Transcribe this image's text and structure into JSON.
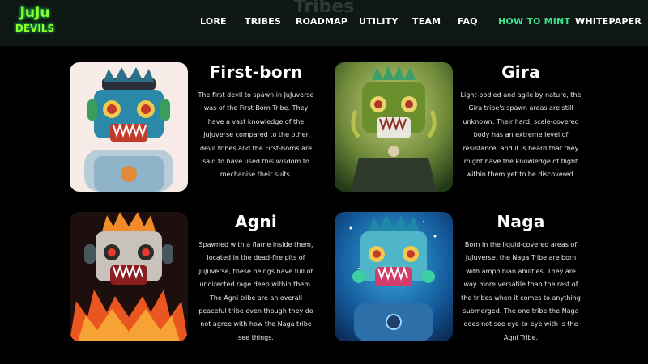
{
  "header": {
    "logo_line1": "JuJu",
    "logo_line2": "DEVILS",
    "ghost_heading": "Tribes",
    "nav": [
      {
        "label": "LORE",
        "active": false
      },
      {
        "label": "TRIBES",
        "active": false
      },
      {
        "label": "ROADMAP",
        "active": false
      },
      {
        "label": "UTILITY",
        "active": false
      },
      {
        "label": "TEAM",
        "active": false
      },
      {
        "label": "FAQ",
        "active": false
      },
      {
        "label": "HOW TO MINT",
        "active": true
      },
      {
        "label": "WHITEPAPER",
        "active": false
      }
    ]
  },
  "colors": {
    "accent": "#3fe08c",
    "logo_green": "#8dff2c",
    "nav_bg": "#0e1714",
    "page_bg": "#000000"
  },
  "tribes": [
    {
      "name": "First-born",
      "image_icon": "first-born-devil-portrait",
      "description": "The first devil to spawn in JuJuverse was of the First-Born Tribe. They have a vast knowledge of the JuJuverse compared to the other devil tribes and the First-Borns are said to have used this wisdom to mechanise their suits."
    },
    {
      "name": "Gira",
      "image_icon": "gira-devil-portrait",
      "description": "Light-bodied and agile by nature, the Gira tribe's spawn areas are still unknown. Their hard, scale-covered body has an extreme level of resistance, and it is heard that they might have the knowledge of flight within them yet to be discovered."
    },
    {
      "name": "Agni",
      "image_icon": "agni-devil-portrait",
      "description": "Spawned with a flame inside them, located in the dead-fire pits of JuJuverse, these beings have full of undirected rage deep within them. The Agni tribe are an overall peaceful tribe even though they do not agree with how the Naga tribe see things."
    },
    {
      "name": "Naga",
      "image_icon": "naga-devil-portrait",
      "description": "Born in the liquid-covered areas of JuJuverse, the Naga Tribe are born with amphibian abilities. They are way more versatile than the rest of the tribes when it comes to anything submerged. The one tribe the Naga does not see eye-to-eye with is the Agni Tribe."
    }
  ]
}
